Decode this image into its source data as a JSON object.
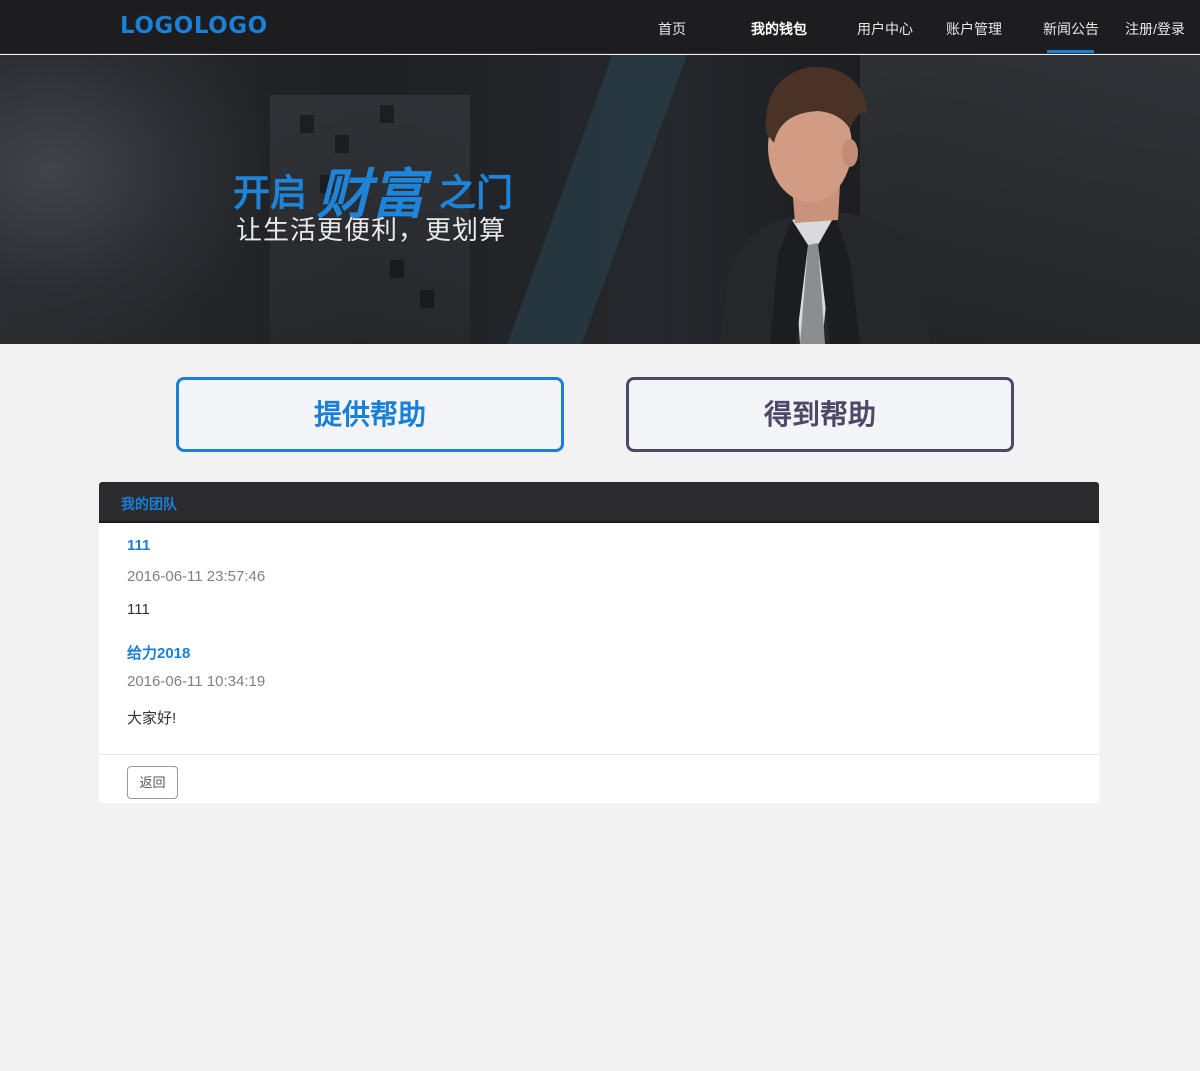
{
  "nav": {
    "logo": "LOGOLOGO",
    "items": [
      {
        "label": "首页"
      },
      {
        "label": "我的钱包"
      },
      {
        "label": "用户中心"
      },
      {
        "label": "账户管理"
      },
      {
        "label": "新闻公告"
      },
      {
        "label": "注册/登录"
      }
    ],
    "active_item": "新闻公告",
    "accent_color": "#1a7fd6"
  },
  "banner": {
    "title_a": "开启",
    "title_b": "财富",
    "title_c": "之门",
    "subtitle": "让生活更便利，更划算"
  },
  "actions": {
    "give_label": "提供帮助",
    "get_label": "得到帮助"
  },
  "panel": {
    "title": "我的团队",
    "posts": [
      {
        "title": "111",
        "time": "2016-06-11 23:57:46",
        "body": "111"
      },
      {
        "title": "给力2018",
        "time": "2016-06-11 10:34:19",
        "body": "大家好!"
      }
    ],
    "back_label": "返回"
  }
}
